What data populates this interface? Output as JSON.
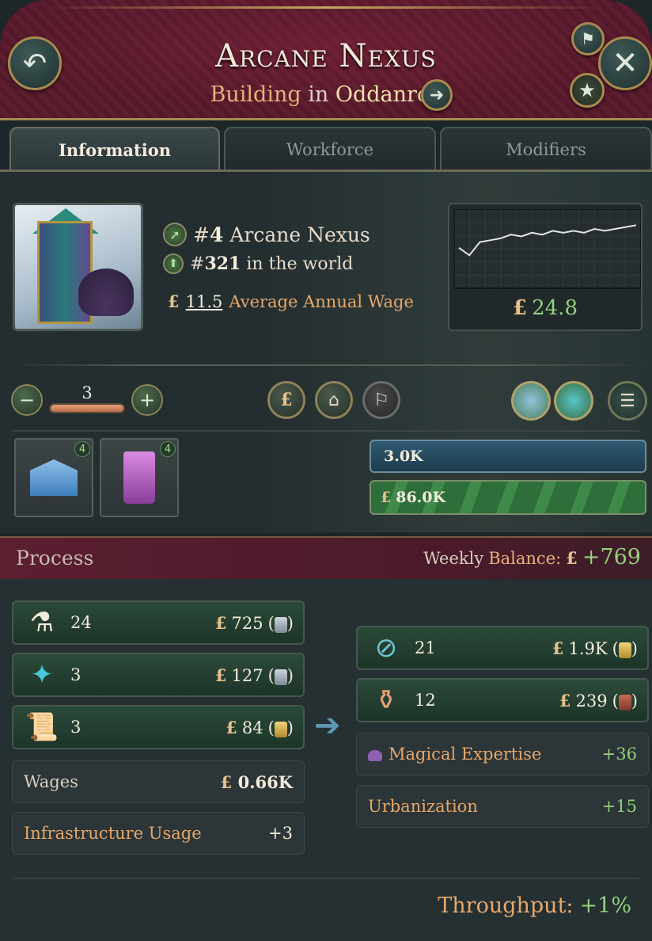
{
  "header": {
    "title": "Arcane Nexus",
    "subtitle_type": "Building",
    "subtitle_in": "in",
    "subtitle_location": "Oddanroy"
  },
  "tabs": [
    {
      "label": "Information",
      "active": true
    },
    {
      "label": "Workforce",
      "active": false
    },
    {
      "label": "Modifiers",
      "active": false
    }
  ],
  "info": {
    "rank_local_prefix": "#",
    "rank_local_number": "4",
    "rank_local_name": "Arcane Nexus",
    "rank_world_prefix": "#",
    "rank_world_number": "321",
    "rank_world_suffix": "in the world",
    "wage_symbol": "£",
    "wage_value": "11.5",
    "wage_label": "Average Annual Wage",
    "graph_value_symbol": "£",
    "graph_value": "24.8"
  },
  "chart_data": {
    "type": "line",
    "series": [
      {
        "values": [
          23.6,
          23.2,
          23.9,
          24.0,
          24.1,
          24.3,
          24.2,
          24.4,
          24.3,
          24.5,
          24.4,
          24.5,
          24.4,
          24.6,
          24.5,
          24.6,
          24.7,
          24.8
        ]
      }
    ],
    "title": "",
    "xlabel": "",
    "ylabel": ""
  },
  "controls": {
    "level": "3",
    "minus_icon": "minus-icon",
    "plus_icon": "plus-icon"
  },
  "building_types": [
    {
      "icon": "bank-icon",
      "count": "4"
    },
    {
      "icon": "potion-icon",
      "count": "4"
    }
  ],
  "bars": {
    "top_value": "3.0K",
    "bottom_symbol": "£",
    "bottom_value": "86.0K"
  },
  "process": {
    "title": "Process",
    "weekly_label_1": "Weekly",
    "weekly_label_2": "Balance:",
    "weekly_symbol": "£",
    "weekly_value": "+769"
  },
  "inputs": [
    {
      "icon": "elixir-icon",
      "qty": "24",
      "symbol": "£",
      "price": "725",
      "coin": "silver"
    },
    {
      "icon": "crystal-icon",
      "qty": "3",
      "symbol": "£",
      "price": "127",
      "coin": "silver"
    },
    {
      "icon": "scroll-icon",
      "qty": "3",
      "symbol": "£",
      "price": "84",
      "coin": "gold"
    }
  ],
  "outputs": [
    {
      "icon": "portal-icon",
      "qty": "21",
      "symbol": "£",
      "price": "1.9K",
      "coin": "gold"
    },
    {
      "icon": "potions-icon",
      "qty": "12",
      "symbol": "£",
      "price": "239",
      "coin": "copper"
    }
  ],
  "stats": {
    "wages_label": "Wages",
    "wages_symbol": "£",
    "wages_value": "0.66K",
    "infra_label": "Infrastructure Usage",
    "infra_value": "+3",
    "expertise_label": "Magical Expertise",
    "expertise_value": "+36",
    "urban_label": "Urbanization",
    "urban_value": "+15"
  },
  "footer": {
    "throughput_label": "Throughput:",
    "throughput_value": "+1%"
  },
  "colors": {
    "header_bg": "#5a1a2c",
    "accent_gold": "#a98a4f",
    "positive_green": "#96d07c",
    "label_orange": "#e7a86a"
  }
}
